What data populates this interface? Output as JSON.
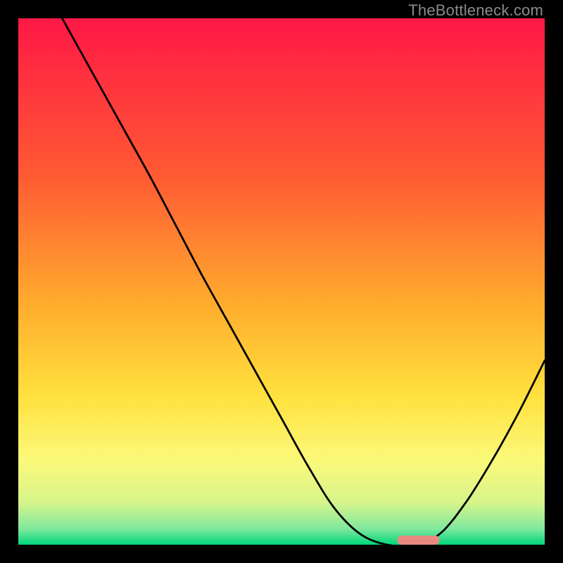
{
  "watermark": "TheBottleneck.com",
  "chart_data": {
    "type": "line",
    "title": "",
    "xlabel": "",
    "ylabel": "",
    "xlim": [
      0,
      100
    ],
    "ylim": [
      0,
      100
    ],
    "grid": false,
    "series": [
      {
        "name": "curve",
        "x": [
          0,
          5,
          10,
          15,
          20,
          25,
          30,
          35,
          40,
          45,
          50,
          55,
          60,
          65,
          70,
          75,
          80,
          85,
          90,
          95,
          100
        ],
        "y": [
          115,
          106,
          97,
          88,
          79,
          70,
          60.5,
          51,
          42,
          33,
          24,
          15,
          7,
          2,
          0,
          0,
          2,
          8,
          16,
          25,
          35
        ]
      }
    ],
    "marker": {
      "x_start": 72,
      "x_end": 80,
      "y": 0
    },
    "gradient_stops": [
      {
        "pos": 0.0,
        "color": "#ff1846"
      },
      {
        "pos": 0.3,
        "color": "#ff5a33"
      },
      {
        "pos": 0.55,
        "color": "#ffae2d"
      },
      {
        "pos": 0.72,
        "color": "#ffe23f"
      },
      {
        "pos": 0.84,
        "color": "#fbf97a"
      },
      {
        "pos": 0.92,
        "color": "#d6f58b"
      },
      {
        "pos": 0.97,
        "color": "#7fe89d"
      },
      {
        "pos": 1.0,
        "color": "#00d67a"
      }
    ]
  }
}
